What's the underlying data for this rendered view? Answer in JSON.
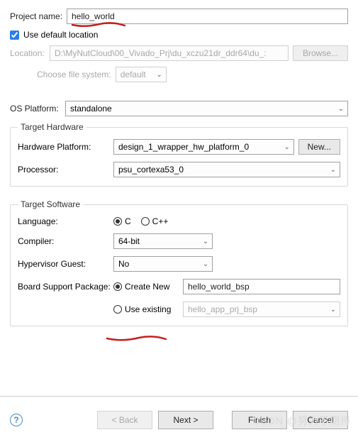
{
  "project": {
    "name_label": "Project name:",
    "name_value": "hello_world",
    "use_default_location_label": "Use default location",
    "location_label": "Location:",
    "location_value": "D:\\MyNutCloud\\00_Vivado_Prj\\du_xczu21dr_ddr64\\du_:",
    "browse_label": "Browse...",
    "choose_fs_label": "Choose file system:",
    "fs_value": "default"
  },
  "os": {
    "label": "OS Platform:",
    "value": "standalone"
  },
  "hw": {
    "legend": "Target Hardware",
    "platform_label": "Hardware Platform:",
    "platform_value": "design_1_wrapper_hw_platform_0",
    "new_label": "New...",
    "processor_label": "Processor:",
    "processor_value": "psu_cortexa53_0"
  },
  "sw": {
    "legend": "Target Software",
    "language_label": "Language:",
    "lang_c": "C",
    "lang_cpp": "C++",
    "compiler_label": "Compiler:",
    "compiler_value": "64-bit",
    "hyp_label": "Hypervisor Guest:",
    "hyp_value": "No",
    "bsp_label": "Board Support Package:",
    "create_new_label": "Create New",
    "create_new_value": "hello_world_bsp",
    "use_existing_label": "Use existing",
    "use_existing_value": "hello_app_prj_bsp"
  },
  "footer": {
    "back": "< Back",
    "next": "Next >",
    "finish": "Finish",
    "cancel": "Cancel"
  },
  "watermark": "CSDN @努力不期待"
}
